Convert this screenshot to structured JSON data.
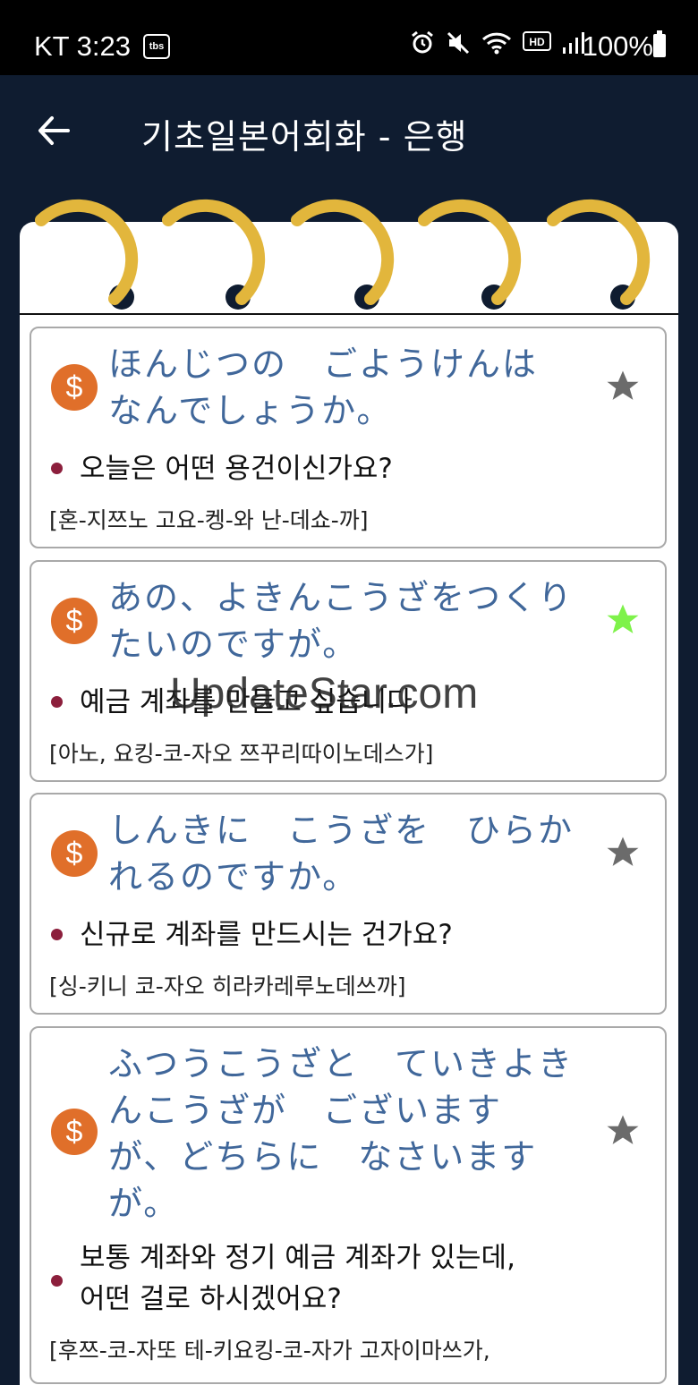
{
  "status_bar": {
    "carrier": "KT",
    "time": "3:23",
    "app_badge": "tbs",
    "battery": "100%"
  },
  "app_bar": {
    "title": "기초일본어회화 - 은행"
  },
  "phrases": [
    {
      "japanese": "ほんじつの　ごようけんは\nなんでしょうか。",
      "korean": "오늘은 어떤 용건이신가요?",
      "pronunciation": "[혼-지쯔노 고요-켕-와 난-데쇼-까]",
      "favorited": false
    },
    {
      "japanese": "あの、よきんこうざをつくり\nたいのですが。",
      "korean": "예금 계좌를 만들고 싶습니다",
      "pronunciation": "[아노, 요킹-코-자오 쯔꾸리따이노데스가]",
      "favorited": true
    },
    {
      "japanese": "しんきに　こうざを　ひらか\nれるのですか。",
      "korean": "신규로 계좌를 만드시는 건가요?",
      "pronunciation": "[싱-키니 코-자오 히라카레루노데쓰까]",
      "favorited": false
    },
    {
      "japanese": "ふつうこうざと　ていきよき\nんこうざが　ございます\nが、どちらに　なさいます\nが。",
      "korean": "보통 계좌와 정기 예금 계좌가 있는데,\n어떤 걸로 하시겠어요?",
      "pronunciation": "[후쯔-코-자또 테-키요킹-코-자가 고자이마쓰가,",
      "favorited": false
    }
  ],
  "watermark": "UpdateStar.com",
  "colors": {
    "header_bg": "#0f1c30",
    "ring": "#e2b63c",
    "japanese_text": "#40679a",
    "dollar_badge": "#e06f2a",
    "bullet": "#8c1f3c",
    "star_off": "#6b6b6b",
    "star_on": "#7ef24a"
  }
}
